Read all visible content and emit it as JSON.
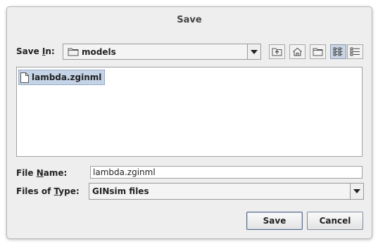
{
  "dialog": {
    "title": "Save"
  },
  "save_in": {
    "label_pre": "Save ",
    "label_mn": "I",
    "label_post": "n:",
    "value": "models"
  },
  "toolbar": {
    "buttons": [
      {
        "name": "up-one-level-icon"
      },
      {
        "name": "home-icon"
      },
      {
        "name": "new-folder-icon"
      },
      {
        "name": "list-view-icon",
        "selected": true
      },
      {
        "name": "details-view-icon"
      }
    ]
  },
  "files": [
    {
      "name": "lambda.zginml",
      "selected": true
    }
  ],
  "file_name": {
    "label_pre": "File ",
    "label_mn": "N",
    "label_post": "ame:",
    "value": "lambda.zginml"
  },
  "files_of_type": {
    "label_pre": "Files of ",
    "label_mn": "T",
    "label_post": "ype:",
    "value": "GINsim files"
  },
  "actions": {
    "save": "Save",
    "cancel": "Cancel"
  }
}
